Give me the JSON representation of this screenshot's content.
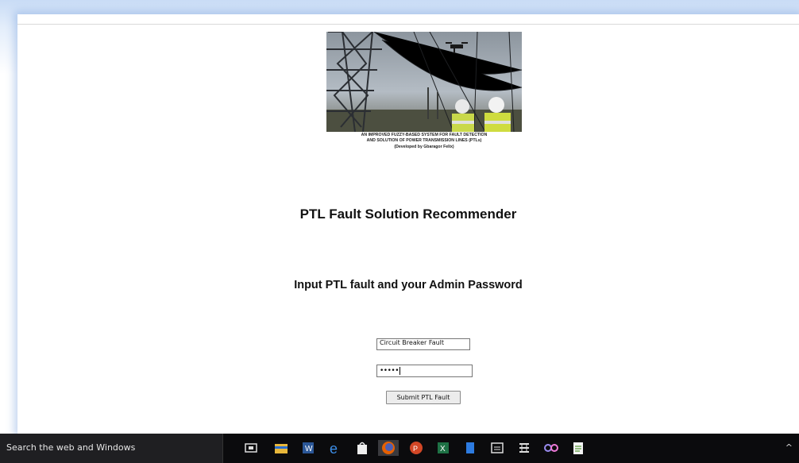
{
  "banner": {
    "caption_line1": "AN IMPROVED FUZZY-BASED SYSTEM FOR FAULT DETECTION",
    "caption_line2": "AND SOLUTION OF POWER TRANSMISSION LINES (PTLs)",
    "caption_line3": "(Developed by Gbaragor Felix)"
  },
  "main": {
    "title": "PTL Fault Solution Recommender",
    "instructions": "Input PTL fault and your Admin Password"
  },
  "form": {
    "fault_value": "Circuit Breaker Fault",
    "password_masked": "•••••",
    "submit_label": "Submit PTL Fault"
  },
  "taskbar": {
    "search_text": "Search the web and Windows",
    "pinned_icons": [
      "task-view-icon",
      "file-explorer-icon",
      "word-icon",
      "edge-icon",
      "store-icon",
      "firefox-icon",
      "powerpoint-icon",
      "excel-icon",
      "app-icon",
      "calculator-icon",
      "network-tool-icon",
      "link-app-icon",
      "notepad-icon"
    ],
    "tray_text": "^"
  }
}
